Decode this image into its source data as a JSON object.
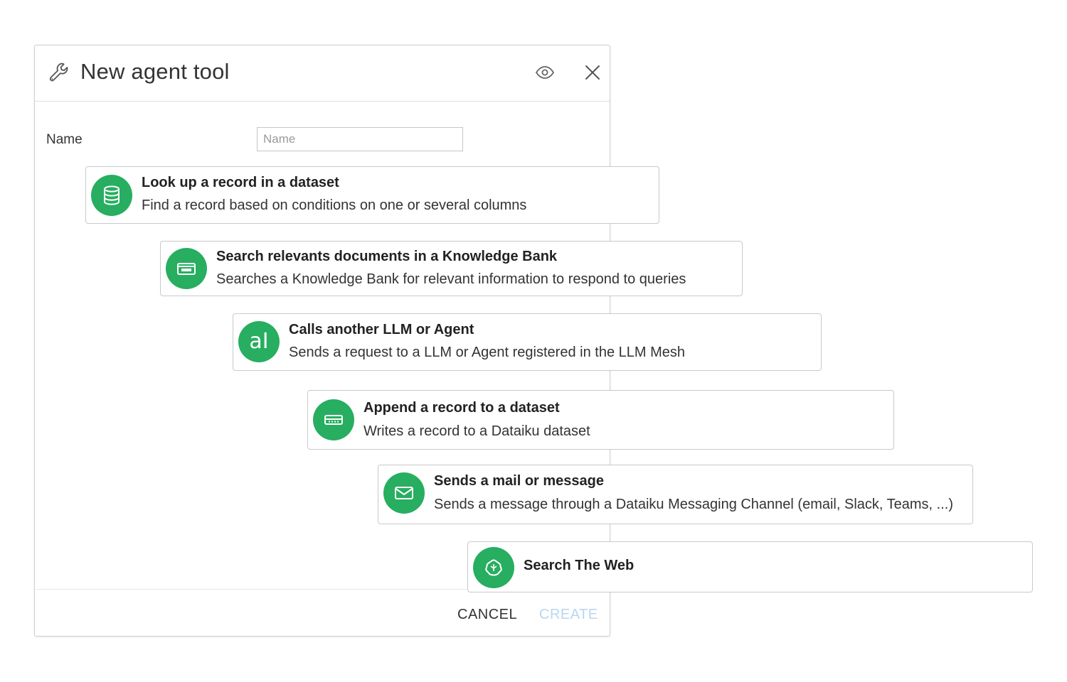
{
  "modal": {
    "title": "New agent tool",
    "icons": {
      "header": "wrench-icon",
      "preview": "eye-icon",
      "close": "close-icon"
    },
    "name_label": "Name",
    "name_placeholder": "Name",
    "name_value": "",
    "cancel_label": "CANCEL",
    "create_label": "CREATE"
  },
  "tools": [
    {
      "title": "Look up a record in a dataset",
      "description": "Find a record based on conditions on one or several columns",
      "icon": "database-icon"
    },
    {
      "title": "Search relevants documents in a Knowledge Bank",
      "description": "Searches a Knowledge Bank for relevant information to respond to queries",
      "icon": "knowledge-bank-icon"
    },
    {
      "title": "Calls another LLM or Agent",
      "description": "Sends a request to a LLM or Agent registered in the LLM Mesh",
      "icon": "llm-icon",
      "glyph": "aI"
    },
    {
      "title": "Append a record to a dataset",
      "description": "Writes a record to a Dataiku dataset",
      "icon": "append-record-icon"
    },
    {
      "title": "Sends a mail or message",
      "description": "Sends a message through a Dataiku Messaging Channel (email, Slack, Teams, ...)",
      "icon": "mail-icon"
    },
    {
      "title": "Search The Web",
      "description": "",
      "icon": "web-search-icon"
    }
  ],
  "colors": {
    "accent_green": "#27ae60",
    "create_disabled": "#b9d6f2",
    "border": "#c9c9c9"
  }
}
